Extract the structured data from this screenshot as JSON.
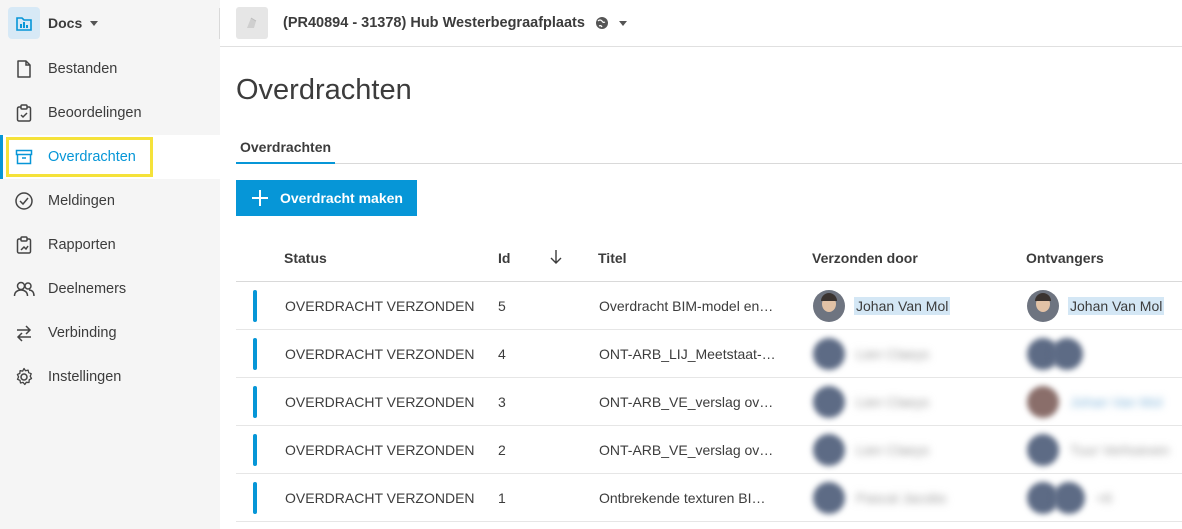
{
  "app": {
    "name": "Docs"
  },
  "project": {
    "name": "(PR40894 - 31378) Hub Westerbegraafplaats"
  },
  "sidebar": {
    "items": [
      {
        "label": "Bestanden",
        "icon": "file-icon",
        "active": false
      },
      {
        "label": "Beoordelingen",
        "icon": "clipboard-icon",
        "active": false
      },
      {
        "label": "Overdrachten",
        "icon": "archive-icon",
        "active": true
      },
      {
        "label": "Meldingen",
        "icon": "check-circle-icon",
        "active": false
      },
      {
        "label": "Rapporten",
        "icon": "report-icon",
        "active": false
      },
      {
        "label": "Deelnemers",
        "icon": "people-icon",
        "active": false
      },
      {
        "label": "Verbinding",
        "icon": "arrows-icon",
        "active": false
      },
      {
        "label": "Instellingen",
        "icon": "gear-icon",
        "active": false
      }
    ]
  },
  "page": {
    "title": "Overdrachten"
  },
  "tabs": [
    {
      "label": "Overdrachten"
    }
  ],
  "actions": {
    "create_label": "Overdracht maken"
  },
  "table": {
    "headers": {
      "status": "Status",
      "id": "Id",
      "title": "Titel",
      "sent_by": "Verzonden door",
      "recipients": "Ontvangers"
    },
    "rows": [
      {
        "status": "OVERDRACHT VERZONDEN",
        "id": "5",
        "title": "Overdracht BIM-model en…",
        "sent_by": "Johan Van Mol",
        "recipients": "Johan Van Mol",
        "blurred": false
      },
      {
        "status": "OVERDRACHT VERZONDEN",
        "id": "4",
        "title": "ONT-ARB_LIJ_Meetstaat-…",
        "sent_by": "Lien Claeys",
        "recipients": "",
        "blurred": true
      },
      {
        "status": "OVERDRACHT VERZONDEN",
        "id": "3",
        "title": "ONT-ARB_VE_verslag ove…",
        "sent_by": "Lien Claeys",
        "recipients": "Johan Van Mol",
        "blurred": true
      },
      {
        "status": "OVERDRACHT VERZONDEN",
        "id": "2",
        "title": "ONT-ARB_VE_verslag ove…",
        "sent_by": "Lien Claeys",
        "recipients": "Tuur Verhoeven",
        "blurred": true
      },
      {
        "status": "OVERDRACHT VERZONDEN",
        "id": "1",
        "title": "Ontbrekende texturen BI…",
        "sent_by": "Pascal Jacobs",
        "recipients": "+6",
        "blurred": true
      }
    ]
  },
  "colors": {
    "accent": "#0696d7",
    "highlight": "#f5e23a",
    "sidebar_bg": "#f5f5f5"
  }
}
